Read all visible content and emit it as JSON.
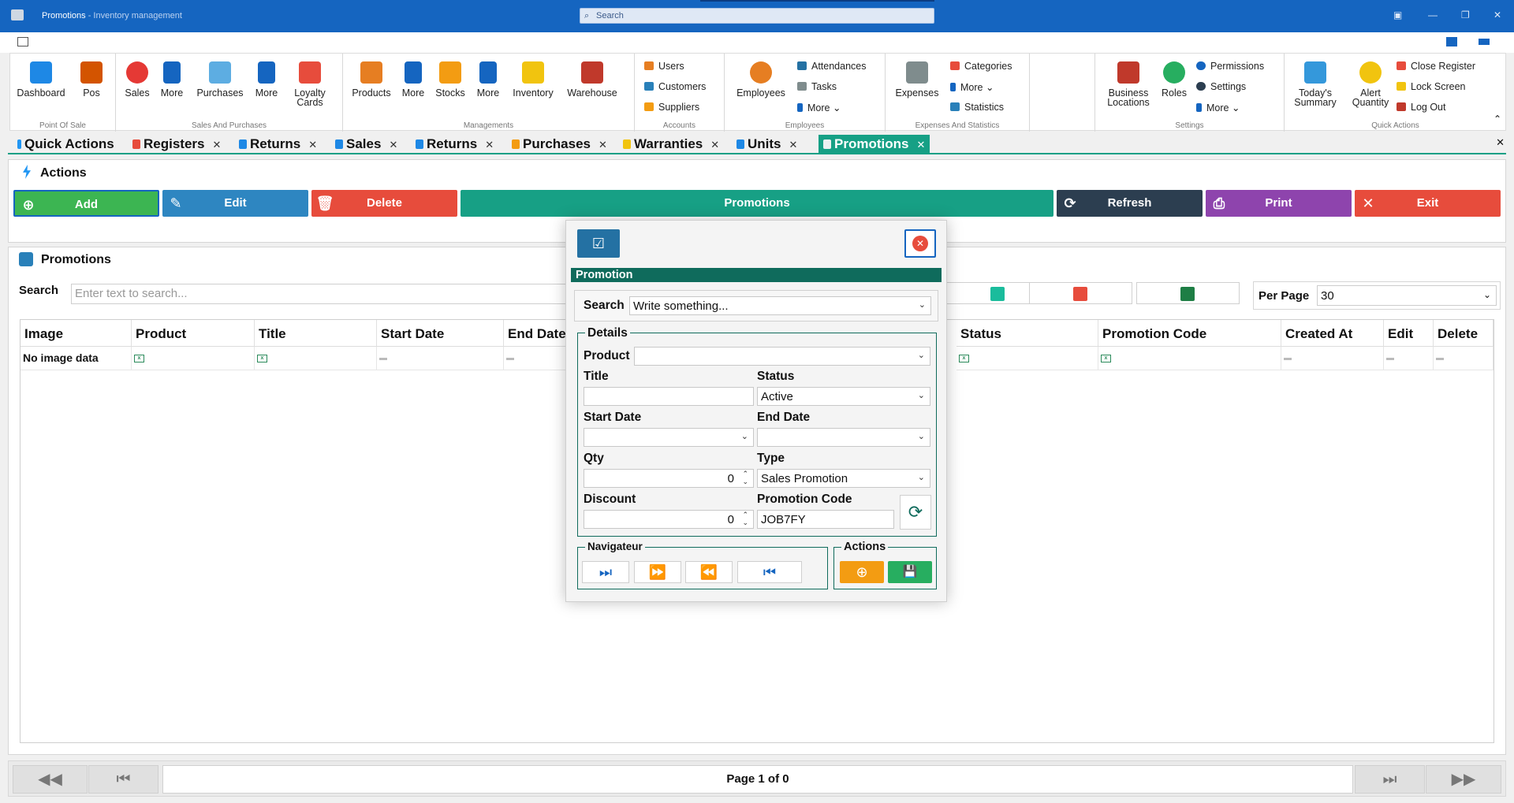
{
  "window": {
    "title": "Promotions",
    "subtitle": " - Inventory management",
    "search_placeholder": "Search"
  },
  "ribbon": {
    "pos": {
      "label": "Point Of Sale",
      "dashboard": "Dashboard",
      "pos": "Pos"
    },
    "sales_purchases": {
      "label": "Sales And Purchases",
      "sales": "Sales",
      "more1": "More",
      "purchases": "Purchases",
      "more2": "More",
      "loyalty1": "Loyalty",
      "loyalty2": "Cards"
    },
    "managements": {
      "label": "Managements",
      "products": "Products",
      "more1": "More",
      "stocks": "Stocks",
      "more2": "More",
      "inventory": "Inventory",
      "warehouse": "Warehouse"
    },
    "accounts": {
      "label": "Accounts",
      "users": "Users",
      "customers": "Customers",
      "suppliers": "Suppliers"
    },
    "employees": {
      "label": "Employees",
      "employees": "Employees",
      "attendances": "Attendances",
      "tasks": "Tasks",
      "more": "More"
    },
    "expenses": {
      "label": "Expenses And Statistics",
      "expenses": "Expenses",
      "categories": "Categories",
      "more": "More",
      "statistics": "Statistics"
    },
    "settings": {
      "label": "Settings",
      "bl1": "Business",
      "bl2": "Locations",
      "roles": "Roles",
      "permissions": "Permissions",
      "settings": "Settings",
      "more": "More"
    },
    "quick": {
      "label": "Quick Actions",
      "ts1": "Today's",
      "ts2": "Summary",
      "aq1": "Alert",
      "aq2": "Quantity",
      "close_register": "Close Register",
      "lock_screen": "Lock Screen",
      "log_out": "Log Out"
    }
  },
  "tabs": [
    {
      "label": "Quick Actions",
      "color": "#2196f3"
    },
    {
      "label": "Registers",
      "color": "#e74c3c"
    },
    {
      "label": "Returns",
      "color": "#1e88e5"
    },
    {
      "label": "Sales",
      "color": "#1e88e5"
    },
    {
      "label": "Returns",
      "color": "#1e88e5"
    },
    {
      "label": "Purchases",
      "color": "#f39c12"
    },
    {
      "label": "Warranties",
      "color": "#f1c40f"
    },
    {
      "label": "Units",
      "color": "#1e88e5"
    },
    {
      "label": "Promotions",
      "color": "#ecf0f1"
    }
  ],
  "actions": {
    "title": "Actions",
    "add": "Add",
    "edit": "Edit",
    "delete": "Delete",
    "promotions": "Promotions",
    "refresh": "Refresh",
    "print": "Print",
    "exit": "Exit"
  },
  "list": {
    "title": "Promotions",
    "search_label": "Search",
    "search_placeholder": "Enter text to search...",
    "per_page_label": "Per Page",
    "per_page_value": "30"
  },
  "table": {
    "columns": [
      "Image",
      "Product",
      "Title",
      "Start Date",
      "End Date",
      "Status",
      "Promotion Code",
      "Created At",
      "Edit",
      "Delete"
    ],
    "row": [
      "No image data"
    ]
  },
  "pager": {
    "info": "Page 1 of 0"
  },
  "dialog": {
    "header": "Promotion",
    "search_label": "Search",
    "search_value": "Write something...",
    "details_label": "Details",
    "product_label": "Product",
    "title_label": "Title",
    "status_label": "Status",
    "status_value": "Active",
    "start_label": "Start Date",
    "end_label": "End Date",
    "qty_label": "Qty",
    "qty_value": "0",
    "type_label": "Type",
    "type_value": "Sales Promotion",
    "discount_label": "Discount",
    "discount_value": "0",
    "code_label": "Promotion Code",
    "code_value": "JOB7FY",
    "nav_label": "Navigateur",
    "actions_label": "Actions"
  }
}
